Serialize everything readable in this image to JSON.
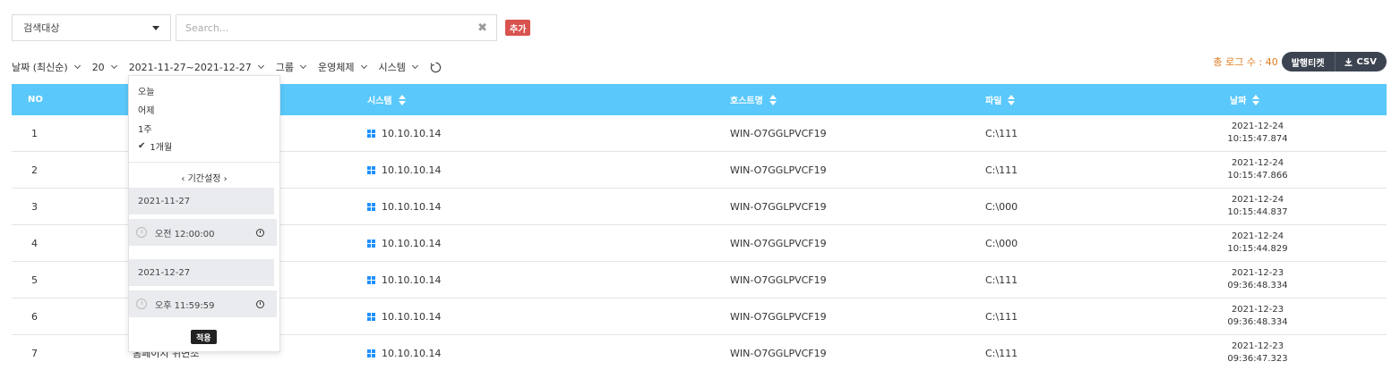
{
  "search": {
    "target_select": "검색대상",
    "placeholder": "Search...",
    "clear_icon": "✖",
    "add_label": "추가"
  },
  "filters": {
    "sort": "날짜 (최신순)",
    "page_size": "20",
    "date_range": "2021-11-27~2021-12-27",
    "group": "그룹",
    "os": "운영체제",
    "system": "시스템"
  },
  "summary": {
    "total_label": "총 로그 수 : 40",
    "ticket_label": "발행티켓",
    "csv_label": "CSV"
  },
  "table": {
    "headers": {
      "no": "NO",
      "system": "시스템",
      "hostname": "호스트명",
      "file": "파일",
      "date": "날짜"
    },
    "rows": [
      {
        "no": "1",
        "group": "",
        "system": "10.10.10.14",
        "hostname": "WIN-O7GGLPVCF19",
        "file": "C:\\111",
        "date": "2021-12-24",
        "time": "10:15:47.874"
      },
      {
        "no": "2",
        "group": "",
        "system": "10.10.10.14",
        "hostname": "WIN-O7GGLPVCF19",
        "file": "C:\\111",
        "date": "2021-12-24",
        "time": "10:15:47.866"
      },
      {
        "no": "3",
        "group": "",
        "system": "10.10.10.14",
        "hostname": "WIN-O7GGLPVCF19",
        "file": "C:\\000",
        "date": "2021-12-24",
        "time": "10:15:44.837"
      },
      {
        "no": "4",
        "group": "",
        "system": "10.10.10.14",
        "hostname": "WIN-O7GGLPVCF19",
        "file": "C:\\000",
        "date": "2021-12-24",
        "time": "10:15:44.829"
      },
      {
        "no": "5",
        "group": "",
        "system": "10.10.10.14",
        "hostname": "WIN-O7GGLPVCF19",
        "file": "C:\\111",
        "date": "2021-12-23",
        "time": "09:36:48.334"
      },
      {
        "no": "6",
        "group": "",
        "system": "10.10.10.14",
        "hostname": "WIN-O7GGLPVCF19",
        "file": "C:\\111",
        "date": "2021-12-23",
        "time": "09:36:48.334"
      },
      {
        "no": "7",
        "group": "홈페이지 위변조",
        "system": "10.10.10.14",
        "hostname": "WIN-O7GGLPVCF19",
        "file": "C:\\111",
        "date": "2021-12-23",
        "time": "09:36:47.323"
      }
    ]
  },
  "date_dropdown": {
    "presets": [
      "오늘",
      "어제",
      "1주",
      "1개월"
    ],
    "selected_preset": "1개월",
    "period_label": "‹ 기간설정 ›",
    "start_date": "2021-11-27",
    "start_time": "오전 12:00:00",
    "end_date": "2021-12-27",
    "end_time": "오후 11:59:59",
    "apply_label": "적용"
  },
  "colors": {
    "header_bg": "#5ac8fa",
    "add_button": "#d9534f",
    "total_count": "#e07b1f",
    "action_buttons": "#3d4451",
    "windows_icon": "#1e90ff"
  },
  "icons": {
    "select_caret": "caret-down-icon",
    "clear": "close-icon",
    "refresh": "refresh-icon",
    "download": "download-icon",
    "os": "windows-icon",
    "sort": "sort-icon",
    "check": "check-icon",
    "clock": "clock-icon"
  }
}
